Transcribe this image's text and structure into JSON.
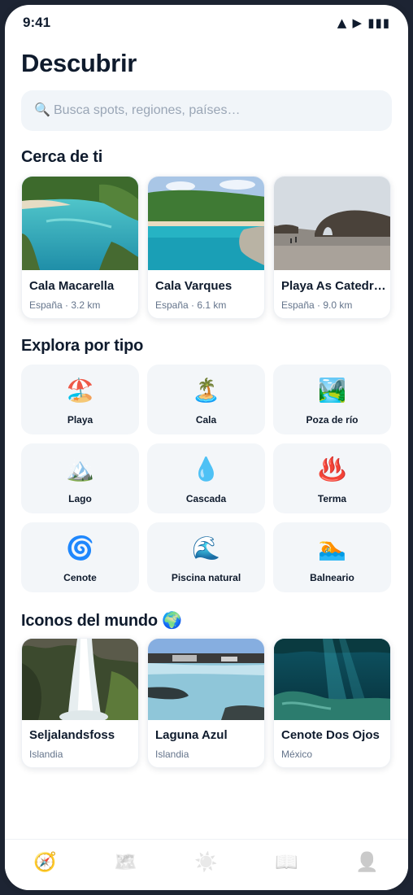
{
  "status_bar": {
    "time": "9:41",
    "icons": "▲ ▶ ▮▮▮"
  },
  "page": {
    "title": "Descubrir"
  },
  "search": {
    "icon": "🔍",
    "placeholder": "Busca spots, regiones, países…"
  },
  "nearby": {
    "title": "Cerca de ti",
    "items": [
      {
        "name": "Cala Macarella",
        "meta": "España · 3.2 km"
      },
      {
        "name": "Cala Varques",
        "meta": "España · 6.1 km"
      },
      {
        "name": "Playa As Catedr…",
        "meta": "España · 9.0 km"
      }
    ]
  },
  "types": {
    "title": "Explora por tipo",
    "items": [
      {
        "emoji": "🏖️",
        "label": "Playa"
      },
      {
        "emoji": "🏝️",
        "label": "Cala"
      },
      {
        "emoji": "🏞️",
        "label": "Poza de río"
      },
      {
        "emoji": "🏔️",
        "label": "Lago"
      },
      {
        "emoji": "💧",
        "label": "Cascada"
      },
      {
        "emoji": "♨️",
        "label": "Terma"
      },
      {
        "emoji": "🌀",
        "label": "Cenote"
      },
      {
        "emoji": "🌊",
        "label": "Piscina natural"
      },
      {
        "emoji": "🏊",
        "label": "Balneario"
      }
    ]
  },
  "icons_world": {
    "title": "Iconos del mundo 🌍",
    "items": [
      {
        "name": "Seljalandsfoss",
        "meta": "Islandia"
      },
      {
        "name": "Laguna Azul",
        "meta": "Islandia"
      },
      {
        "name": "Cenote Dos Ojos",
        "meta": "México"
      }
    ]
  },
  "tab_bar": {
    "items": [
      {
        "icon": "compass-icon",
        "glyph": "🧭",
        "active": true
      },
      {
        "icon": "map-icon",
        "glyph": "🗺️",
        "active": false
      },
      {
        "icon": "sun-icon",
        "glyph": "☀️",
        "active": false
      },
      {
        "icon": "book-icon",
        "glyph": "📖",
        "active": false
      },
      {
        "icon": "profile-icon",
        "glyph": "👤",
        "active": false
      }
    ]
  }
}
